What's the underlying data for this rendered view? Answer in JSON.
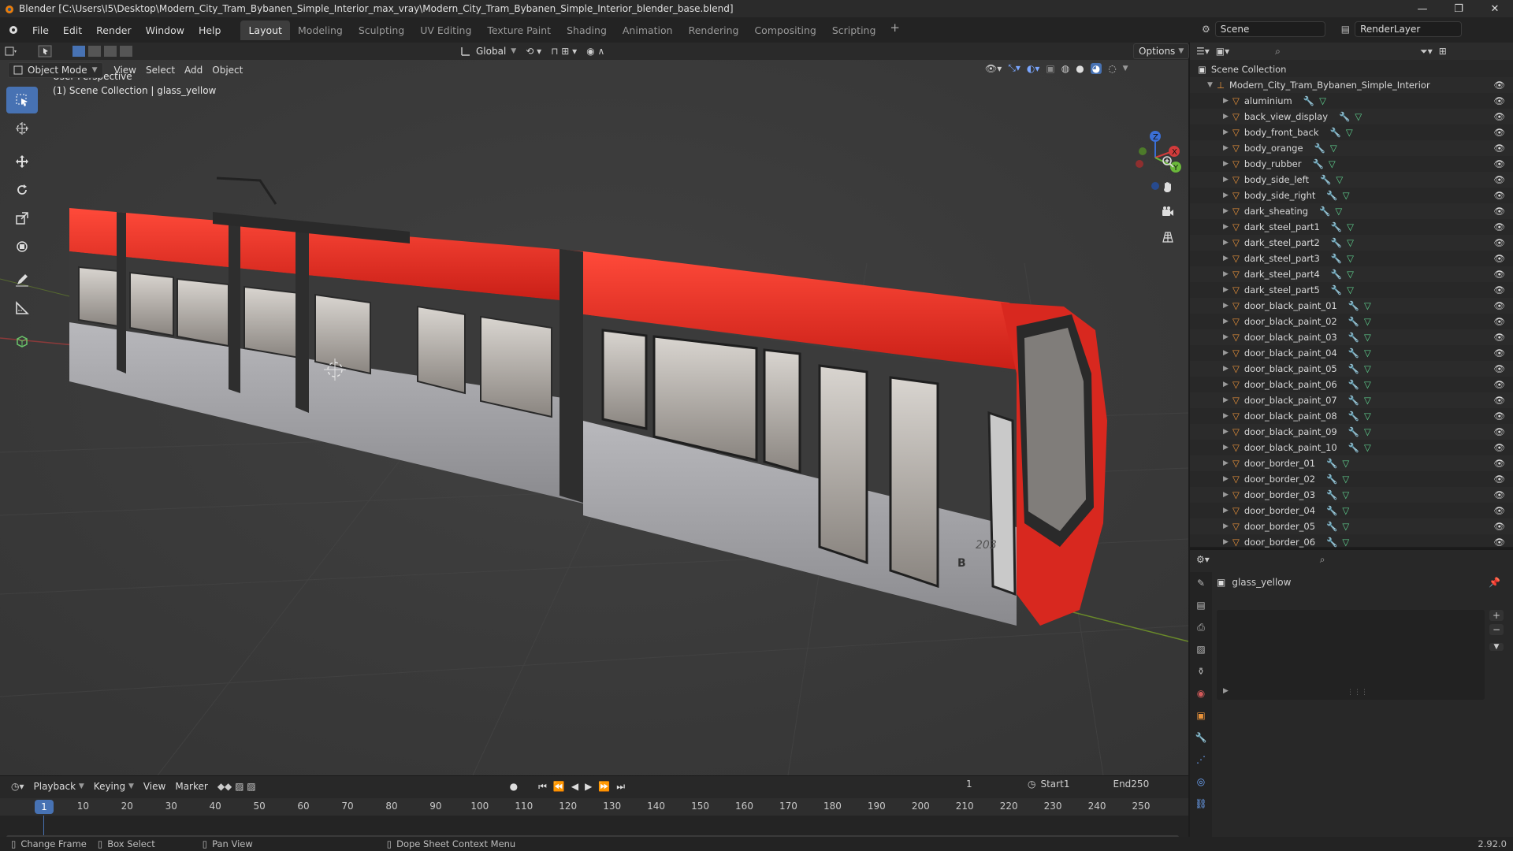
{
  "window": {
    "title": "Blender [C:\\Users\\I5\\Desktop\\Modern_City_Tram_Bybanen_Simple_Interior_max_vray\\Modern_City_Tram_Bybanen_Simple_Interior_blender_base.blend]"
  },
  "menus": [
    "File",
    "Edit",
    "Render",
    "Window",
    "Help"
  ],
  "workspaces": [
    "Layout",
    "Modeling",
    "Sculpting",
    "UV Editing",
    "Texture Paint",
    "Shading",
    "Animation",
    "Rendering",
    "Compositing",
    "Scripting"
  ],
  "active_workspace": "Layout",
  "scene": {
    "name": "Scene",
    "render_layer": "RenderLayer"
  },
  "viewport": {
    "transform_orientation": "Global",
    "options_label": "Options",
    "mode": "Object Mode",
    "menu": [
      "View",
      "Select",
      "Add",
      "Object"
    ],
    "perspective_label": "User Perspective",
    "collection_label": "(1) Scene Collection | glass_yellow",
    "gizmo_axes": [
      "X",
      "Y",
      "Z"
    ]
  },
  "outliner": {
    "root": "Scene Collection",
    "collection": "Modern_City_Tram_Bybanen_Simple_Interior",
    "objects": [
      "aluminium",
      "back_view_display",
      "body_front_back",
      "body_orange",
      "body_rubber",
      "body_side_left",
      "body_side_right",
      "dark_sheating",
      "dark_steel_part1",
      "dark_steel_part2",
      "dark_steel_part3",
      "dark_steel_part4",
      "dark_steel_part5",
      "door_black_paint_01",
      "door_black_paint_02",
      "door_black_paint_03",
      "door_black_paint_04",
      "door_black_paint_05",
      "door_black_paint_06",
      "door_black_paint_07",
      "door_black_paint_08",
      "door_black_paint_09",
      "door_black_paint_10",
      "door_border_01",
      "door_border_02",
      "door_border_03",
      "door_border_04",
      "door_border_05",
      "door_border_06"
    ]
  },
  "properties": {
    "material_name": "glass_yellow"
  },
  "timeline": {
    "menus": [
      "Playback",
      "Keying",
      "View",
      "Marker"
    ],
    "current_frame": "1",
    "start_label": "Start",
    "start": "1",
    "end_label": "End",
    "end": "250",
    "ticks": [
      "1",
      "10",
      "20",
      "30",
      "40",
      "50",
      "60",
      "70",
      "80",
      "90",
      "100",
      "110",
      "120",
      "130",
      "140",
      "150",
      "160",
      "170",
      "180",
      "190",
      "200",
      "210",
      "220",
      "230",
      "240",
      "250"
    ]
  },
  "statusbar": {
    "items": [
      "Change Frame",
      "Box Select",
      "Pan View",
      "Dope Sheet Context Menu"
    ],
    "version": "2.92.0"
  },
  "colors": {
    "accent": "#4772b3",
    "tram_red": "#e02a22",
    "object_icon": "#e8923a",
    "mesh_icon": "#5fd18f",
    "modifier_icon": "#6fa8ff"
  }
}
